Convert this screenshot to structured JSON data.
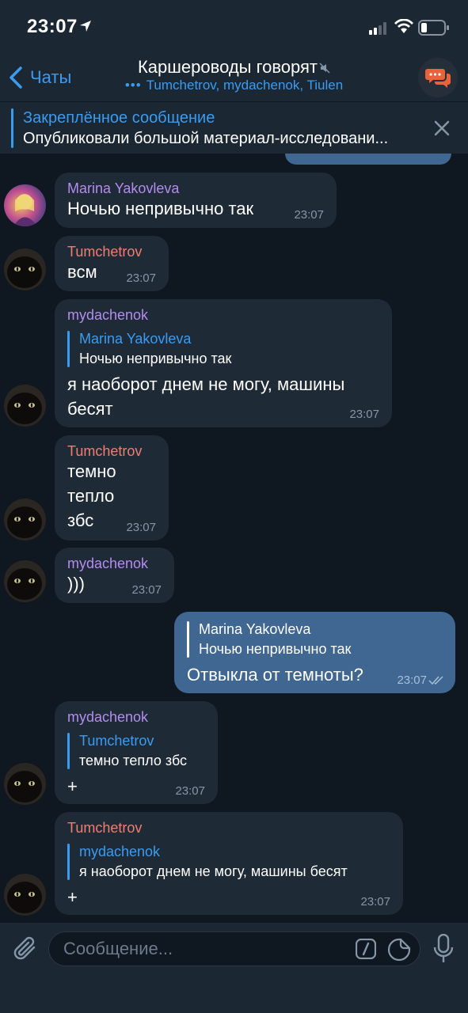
{
  "status_bar": {
    "time": "23:07"
  },
  "nav": {
    "back_label": "Чаты",
    "title": "Каршероводы говорят",
    "typing_dots": "•••",
    "subtitle": "Tumchetrov, mydachenok, Tiulen"
  },
  "pinned": {
    "title": "Закреплённое сообщение",
    "text": "Опубликовали большой материал-исследовани..."
  },
  "messages": [
    {
      "sender": "Marina Yakovleva",
      "text": "Ночью непривычно так",
      "time": "23:07"
    },
    {
      "sender": "Tumchetrov",
      "text": "всм",
      "time": "23:07"
    },
    {
      "sender": "mydachenok",
      "reply_name": "Marina Yakovleva",
      "reply_text": "Ночью непривычно так",
      "line1": "я наоборот днем не могу, машины",
      "line2": "бесят",
      "time": "23:07"
    },
    {
      "sender": "Tumchetrov",
      "line1": "темно",
      "line2": "тепло",
      "line3": "збс",
      "time": "23:07"
    },
    {
      "sender": "mydachenok",
      "text": ")))",
      "time": "23:07"
    },
    {
      "reply_name": "Marina Yakovleva",
      "reply_text": "Ночью непривычно так",
      "text": "Отвыкла от темноты?",
      "time": "23:07"
    },
    {
      "sender": "mydachenok",
      "reply_name": "Tumchetrov",
      "reply_text": "темно тепло збс",
      "text": "+",
      "time": "23:07"
    },
    {
      "sender": "Tumchetrov",
      "reply_name": "mydachenok",
      "reply_text": "я наоборот днем не могу, машины бесят",
      "text": "+",
      "time": "23:07"
    }
  ],
  "input": {
    "placeholder": "Сообщение..."
  },
  "colors": {
    "accent": "#3a9cf0",
    "background": "#0f1720",
    "bar": "#1c2734",
    "incoming_bubble": "#1f2a37",
    "outgoing_bubble": "#3f6791",
    "name_purple": "#b48cf0",
    "name_red": "#f07e6e"
  },
  "icons": [
    "location-arrow-icon",
    "signal-icon",
    "wifi-icon",
    "battery-icon",
    "chevron-left-icon",
    "mute-icon",
    "chat-bubbles-icon",
    "close-icon",
    "paperclip-icon",
    "slash-command-icon",
    "sticker-icon",
    "microphone-icon",
    "double-check-icon"
  ]
}
